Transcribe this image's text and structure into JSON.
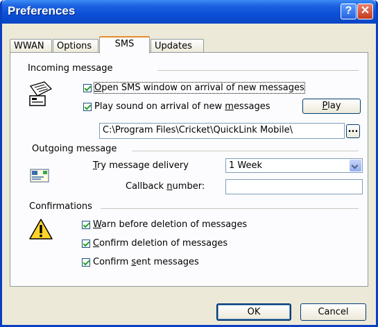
{
  "window": {
    "title": "Preferences",
    "help_glyph": "?",
    "close_glyph": "✕"
  },
  "tabs": [
    {
      "label": "WWAN"
    },
    {
      "label": "Options"
    },
    {
      "label": "SMS"
    },
    {
      "label": "Updates"
    }
  ],
  "incoming": {
    "label": "Incoming message",
    "open_window": {
      "pre": "",
      "u": "O",
      "post": "pen SMS window on arrival of new messages",
      "checked": true
    },
    "play_sound": {
      "pre": "Play sound on arrival of new ",
      "u": "m",
      "post": "essages",
      "checked": true
    },
    "play_button": {
      "u": "P",
      "post": "lay"
    },
    "sound_path": "C:\\Program Files\\Cricket\\QuickLink Mobile\\",
    "browse_button": "..."
  },
  "outgoing": {
    "label": "Outgoing message",
    "try_delivery": {
      "u": "T",
      "post": "ry message delivery"
    },
    "delivery_value": "1 Week",
    "callback": {
      "pre": "Callback ",
      "u": "n",
      "post": "umber:"
    },
    "callback_value": ""
  },
  "confirmations": {
    "label": "Confirmations",
    "warn_delete": {
      "u": "W",
      "post": "arn before deletion of messages",
      "checked": true
    },
    "confirm_delete": {
      "u": "C",
      "post": "onfirm deletion of messages",
      "checked": true
    },
    "confirm_sent": {
      "pre": "Confirm ",
      "u": "s",
      "post": "ent messages",
      "checked": true
    }
  },
  "footer": {
    "ok": "OK",
    "cancel": "Cancel"
  },
  "colors": {
    "titlebar": "#0b4ed6",
    "check": "#21a121",
    "tab_highlight": "#e68b2c",
    "face": "#ece9d8"
  }
}
